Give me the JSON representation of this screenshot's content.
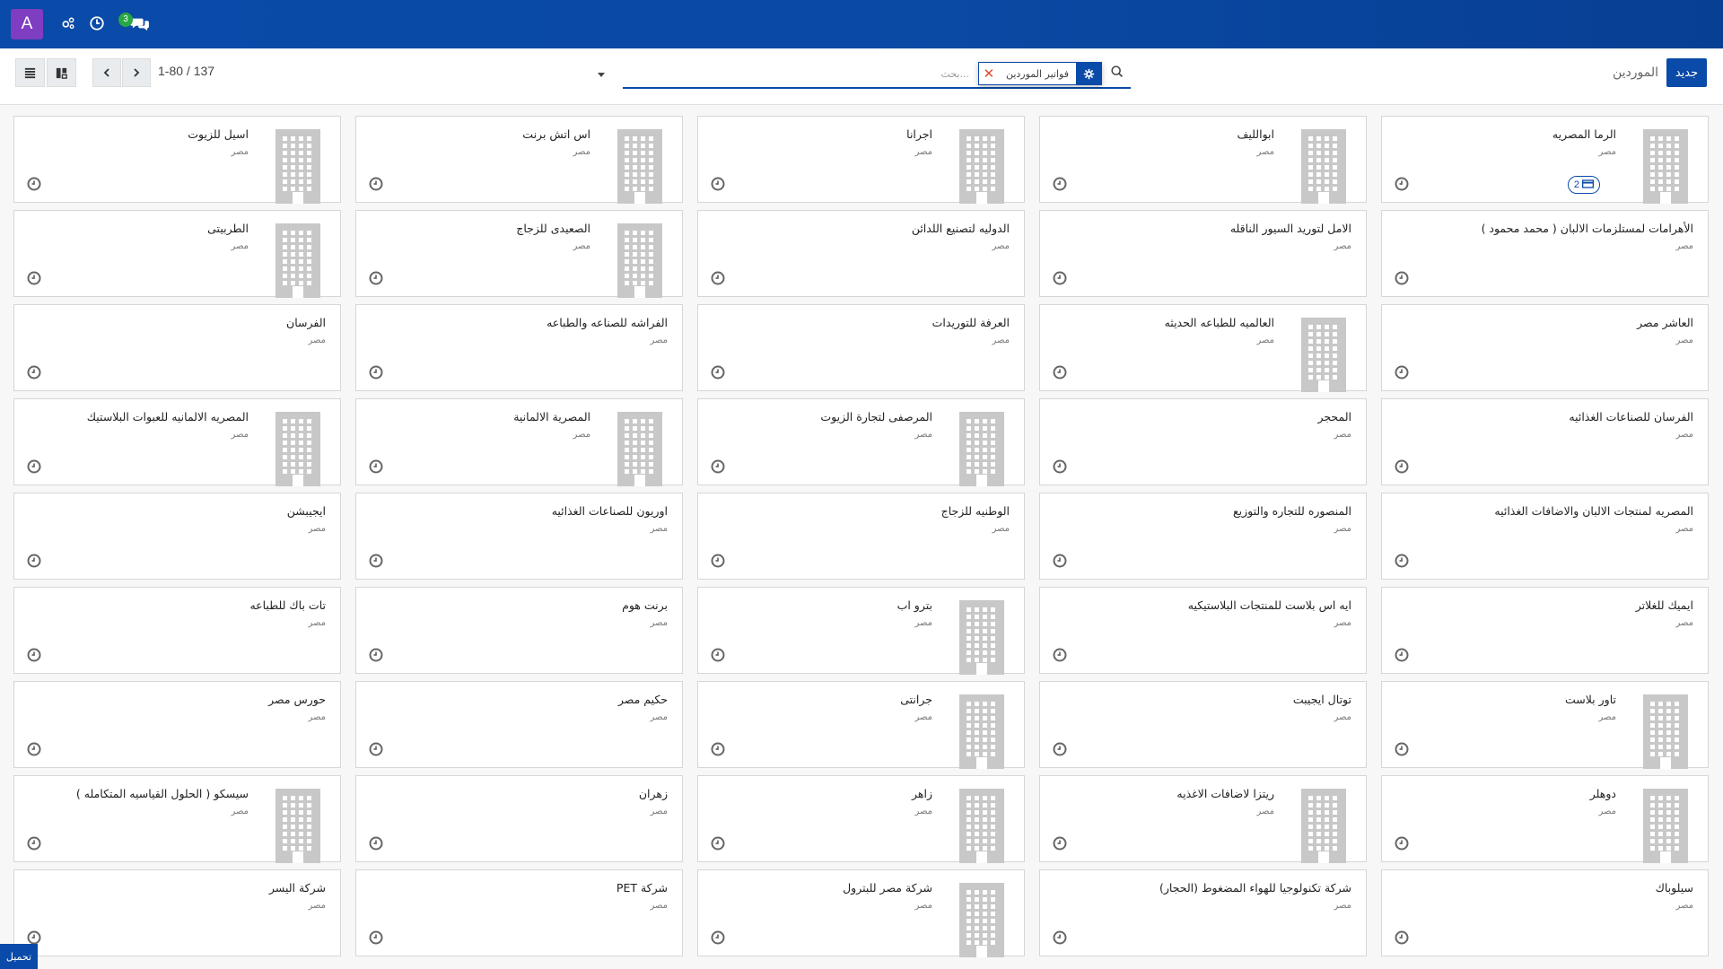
{
  "navbar": {
    "avatar_letter": "A",
    "icons": [
      "settings-gears-icon",
      "clock-icon",
      "chat-icon"
    ],
    "chat_count": "3"
  },
  "control": {
    "new_button": "جديد",
    "breadcrumb": "الموردين",
    "search_placeholder": "بحث...",
    "facet_value": "فواتير الموردين",
    "pager_value": "1-80 / 137"
  },
  "cards": [
    {
      "name": "الرما المصريه",
      "country": "مصر",
      "image": true,
      "badge": "2"
    },
    {
      "name": "ابوالليف",
      "country": "مصر",
      "image": true
    },
    {
      "name": "اجرانا",
      "country": "مصر",
      "image": true
    },
    {
      "name": "اس اتش برنت",
      "country": "مصر",
      "image": true
    },
    {
      "name": "اسيل للزيوت",
      "country": "مصر",
      "image": true
    },
    {
      "name": "الأهرامات لمستلزمات الالبان ( محمد محمود )",
      "country": "مصر",
      "image": false
    },
    {
      "name": "الامل لتوريد السيور الناقله",
      "country": "مصر",
      "image": false
    },
    {
      "name": "الدوليه لتصنيع اللدائن",
      "country": "مصر",
      "image": false
    },
    {
      "name": "الصعيدى للزجاج",
      "country": "مصر",
      "image": true
    },
    {
      "name": "الطربيتى",
      "country": "مصر",
      "image": true
    },
    {
      "name": "العاشر مصر",
      "country": "مصر",
      "image": false
    },
    {
      "name": "العالميه للطباعه الحديثه",
      "country": "مصر",
      "image": true
    },
    {
      "name": "العرفة للتوريدات",
      "country": "مصر",
      "image": false
    },
    {
      "name": "الفراشه للصناعه والطباعه",
      "country": "مصر",
      "image": false
    },
    {
      "name": "الفرسان",
      "country": "مصر",
      "image": false
    },
    {
      "name": "الفرسان للصناعات الغذائيه",
      "country": "مصر",
      "image": false
    },
    {
      "name": "المحجر",
      "country": "مصر",
      "image": false
    },
    {
      "name": "المرصفى لتجارة الزيوت",
      "country": "مصر",
      "image": true
    },
    {
      "name": "المصرية الالمانية",
      "country": "مصر",
      "image": true
    },
    {
      "name": "المصريه الالمانيه للعبوات البلاستيك",
      "country": "مصر",
      "image": true
    },
    {
      "name": "المصريه لمنتجات الالبان والاضافات الغذائيه",
      "country": "مصر",
      "image": false
    },
    {
      "name": "المنصوره للتجاره والتوزيع",
      "country": "مصر",
      "image": false
    },
    {
      "name": "الوطنيه للزجاج",
      "country": "مصر",
      "image": false
    },
    {
      "name": "اوريون للصناعات الغذائيه",
      "country": "مصر",
      "image": false
    },
    {
      "name": "ايجيبشن",
      "country": "مصر",
      "image": false
    },
    {
      "name": "ايميك للغلاتر",
      "country": "مصر",
      "image": false
    },
    {
      "name": "ايه اس بلاست للمنتجات البلاستيكيه",
      "country": "مصر",
      "image": false
    },
    {
      "name": "بترو اب",
      "country": "مصر",
      "image": true
    },
    {
      "name": "برنت هوم",
      "country": "مصر",
      "image": false
    },
    {
      "name": "تات باك للطباعه",
      "country": "مصر",
      "image": false
    },
    {
      "name": "تاور بلاست",
      "country": "مصر",
      "image": true
    },
    {
      "name": "توتال ايجيبت",
      "country": "مصر",
      "image": false
    },
    {
      "name": "جرانتى",
      "country": "مصر",
      "image": true
    },
    {
      "name": "حكيم مصر",
      "country": "مصر",
      "image": false
    },
    {
      "name": "حورس مصر",
      "country": "مصر",
      "image": false
    },
    {
      "name": "دوهلر",
      "country": "مصر",
      "image": true
    },
    {
      "name": "ريتزا لاضافات الاغذيه",
      "country": "مصر",
      "image": true
    },
    {
      "name": "زاهر",
      "country": "مصر",
      "image": true
    },
    {
      "name": "زهران",
      "country": "مصر",
      "image": false
    },
    {
      "name": "سيسكو ( الحلول القياسيه المتكامله )",
      "country": "مصر",
      "image": true
    },
    {
      "name": "سيلوباك",
      "country": "مصر",
      "image": false
    },
    {
      "name": "شركة تكنولوجيا للهواء المضغوط (الحجار)",
      "country": "مصر",
      "image": false
    },
    {
      "name": "شركة مصر للبترول",
      "country": "مصر",
      "image": true
    },
    {
      "name": "شركة PET",
      "country": "مصر",
      "image": false
    },
    {
      "name": "شركة اليسر",
      "country": "مصر",
      "image": false
    }
  ],
  "download_tab": "تحميل"
}
